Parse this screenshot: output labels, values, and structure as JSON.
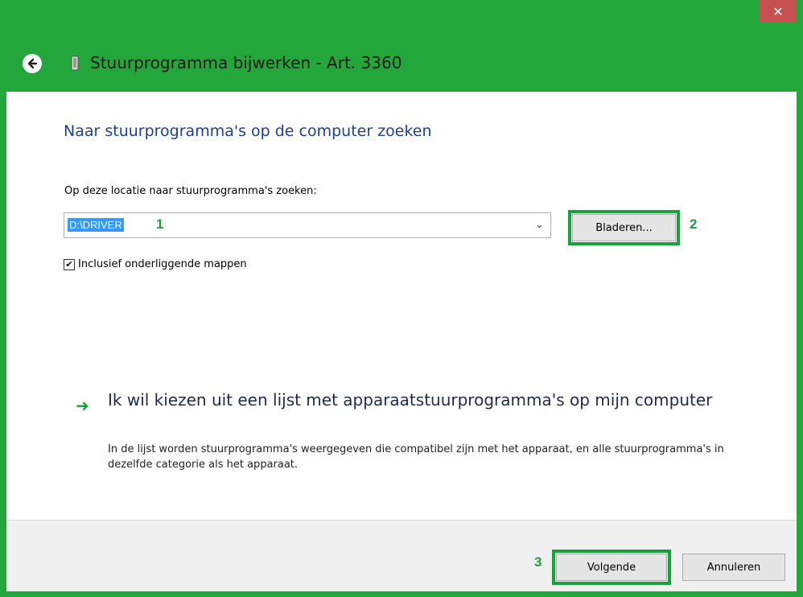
{
  "window": {
    "title": "Stuurprogramma bijwerken - Art. 3360",
    "close_label": "✕"
  },
  "main": {
    "heading": "Naar stuurprogramma's op de computer zoeken",
    "location_label": "Op deze locatie naar stuurprogramma's zoeken:",
    "path_value": "D:\\DRIVER",
    "browse_label": "Bladeren...",
    "include_subfolders_label": "Inclusief onderliggende mappen",
    "include_subfolders_checked": true,
    "choose_title": "Ik wil kiezen uit een lijst met apparaatstuurprogramma's op mijn computer",
    "choose_desc": "In de lijst worden stuurprogramma's weergegeven die compatibel zijn met het apparaat, en alle stuurprogramma's in dezelfde categorie als het apparaat."
  },
  "footer": {
    "next_label": "Volgende",
    "cancel_label": "Annuleren"
  },
  "annotations": {
    "step1": "1",
    "step2": "2",
    "step3": "3"
  },
  "colors": {
    "frame": "#23a63a",
    "accent_text": "#1c3f95",
    "highlight": "#16a33a",
    "selection": "#3399ff"
  }
}
